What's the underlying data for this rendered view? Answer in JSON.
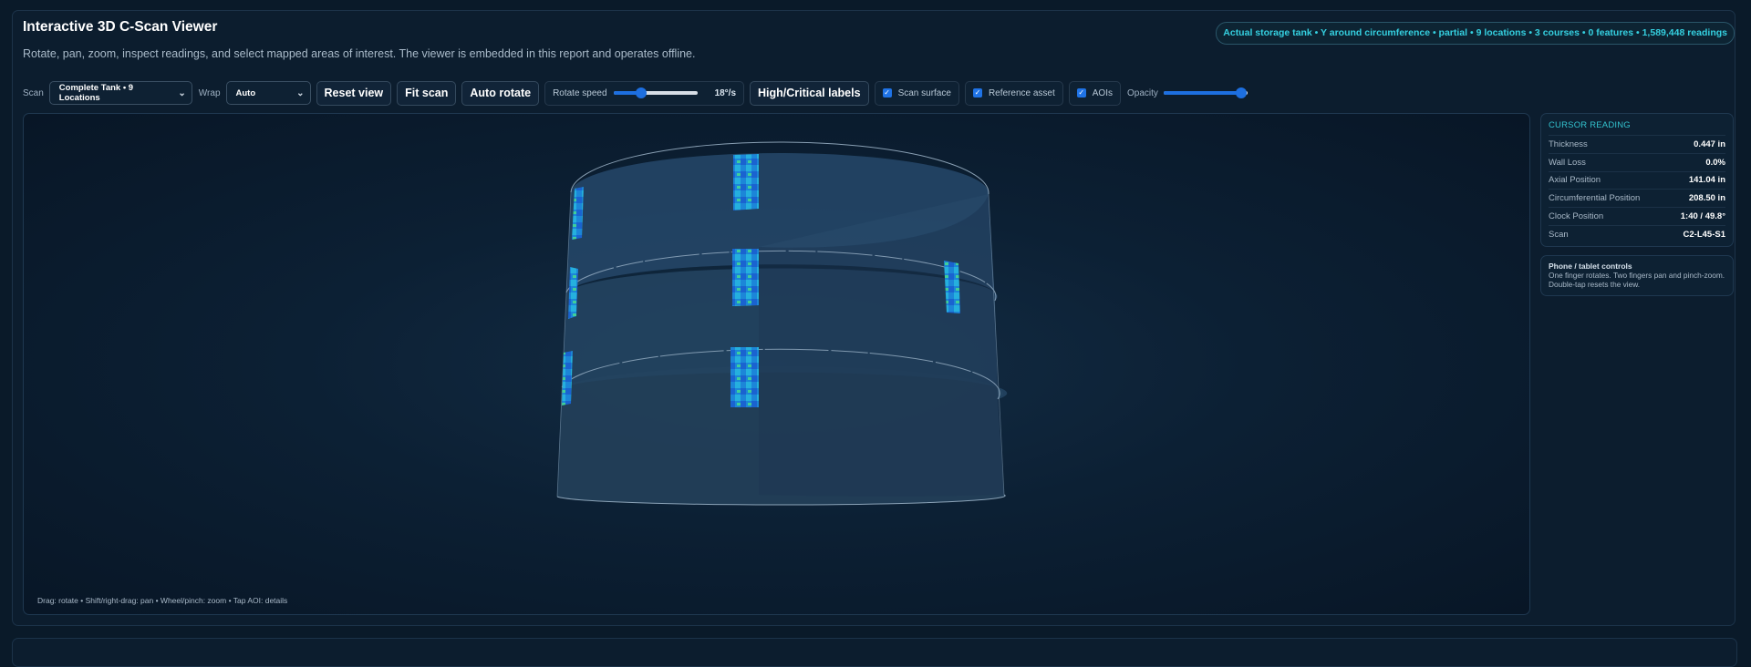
{
  "header": {
    "title": "Interactive 3D C-Scan Viewer",
    "subtitle": "Rotate, pan, zoom, inspect readings, and select mapped areas of interest. The viewer is embedded in this report and operates offline.",
    "summary": "Actual storage tank • Y around circumference • partial • 9 locations • 3 courses • 0 features • 1,589,448 readings"
  },
  "toolbar": {
    "scan_label": "Scan",
    "scan_value": "Complete Tank • 9 Locations",
    "wrap_label": "Wrap",
    "wrap_value": "Auto",
    "reset_label": "Reset view",
    "fit_label": "Fit scan",
    "auto_rotate_label": "Auto rotate",
    "rotate_speed_label": "Rotate speed",
    "rotate_speed_value": "18°/s",
    "rotate_speed_fraction": 0.33,
    "labels_button": "High/Critical labels",
    "scan_surface_label": "Scan surface",
    "scan_surface_checked": true,
    "reference_asset_label": "Reference asset",
    "reference_asset_checked": true,
    "aois_label": "AOIs",
    "aois_checked": true,
    "opacity_label": "Opacity",
    "opacity_fraction": 0.92
  },
  "viewport": {
    "hint": "Drag: rotate • Shift/right-drag: pan • Wheel/pinch: zoom • Tap AOI: details"
  },
  "cursor_reading": {
    "heading": "CURSOR READING",
    "rows": [
      {
        "label": "Thickness",
        "value": "0.447 in"
      },
      {
        "label": "Wall Loss",
        "value": "0.0%"
      },
      {
        "label": "Axial Position",
        "value": "141.04 in"
      },
      {
        "label": "Circumferential Position",
        "value": "208.50 in"
      },
      {
        "label": "Clock Position",
        "value": "1:40 / 49.8°"
      },
      {
        "label": "Scan",
        "value": "C2-L45-S1"
      }
    ]
  },
  "tips": {
    "title": "Phone / tablet controls",
    "text": "One finger rotates. Two fingers pan and pinch-zoom. Double-tap resets the view."
  },
  "colors": {
    "accent": "#35d0e0",
    "control_blue": "#1d6fe0",
    "background": "#0a1a29"
  }
}
